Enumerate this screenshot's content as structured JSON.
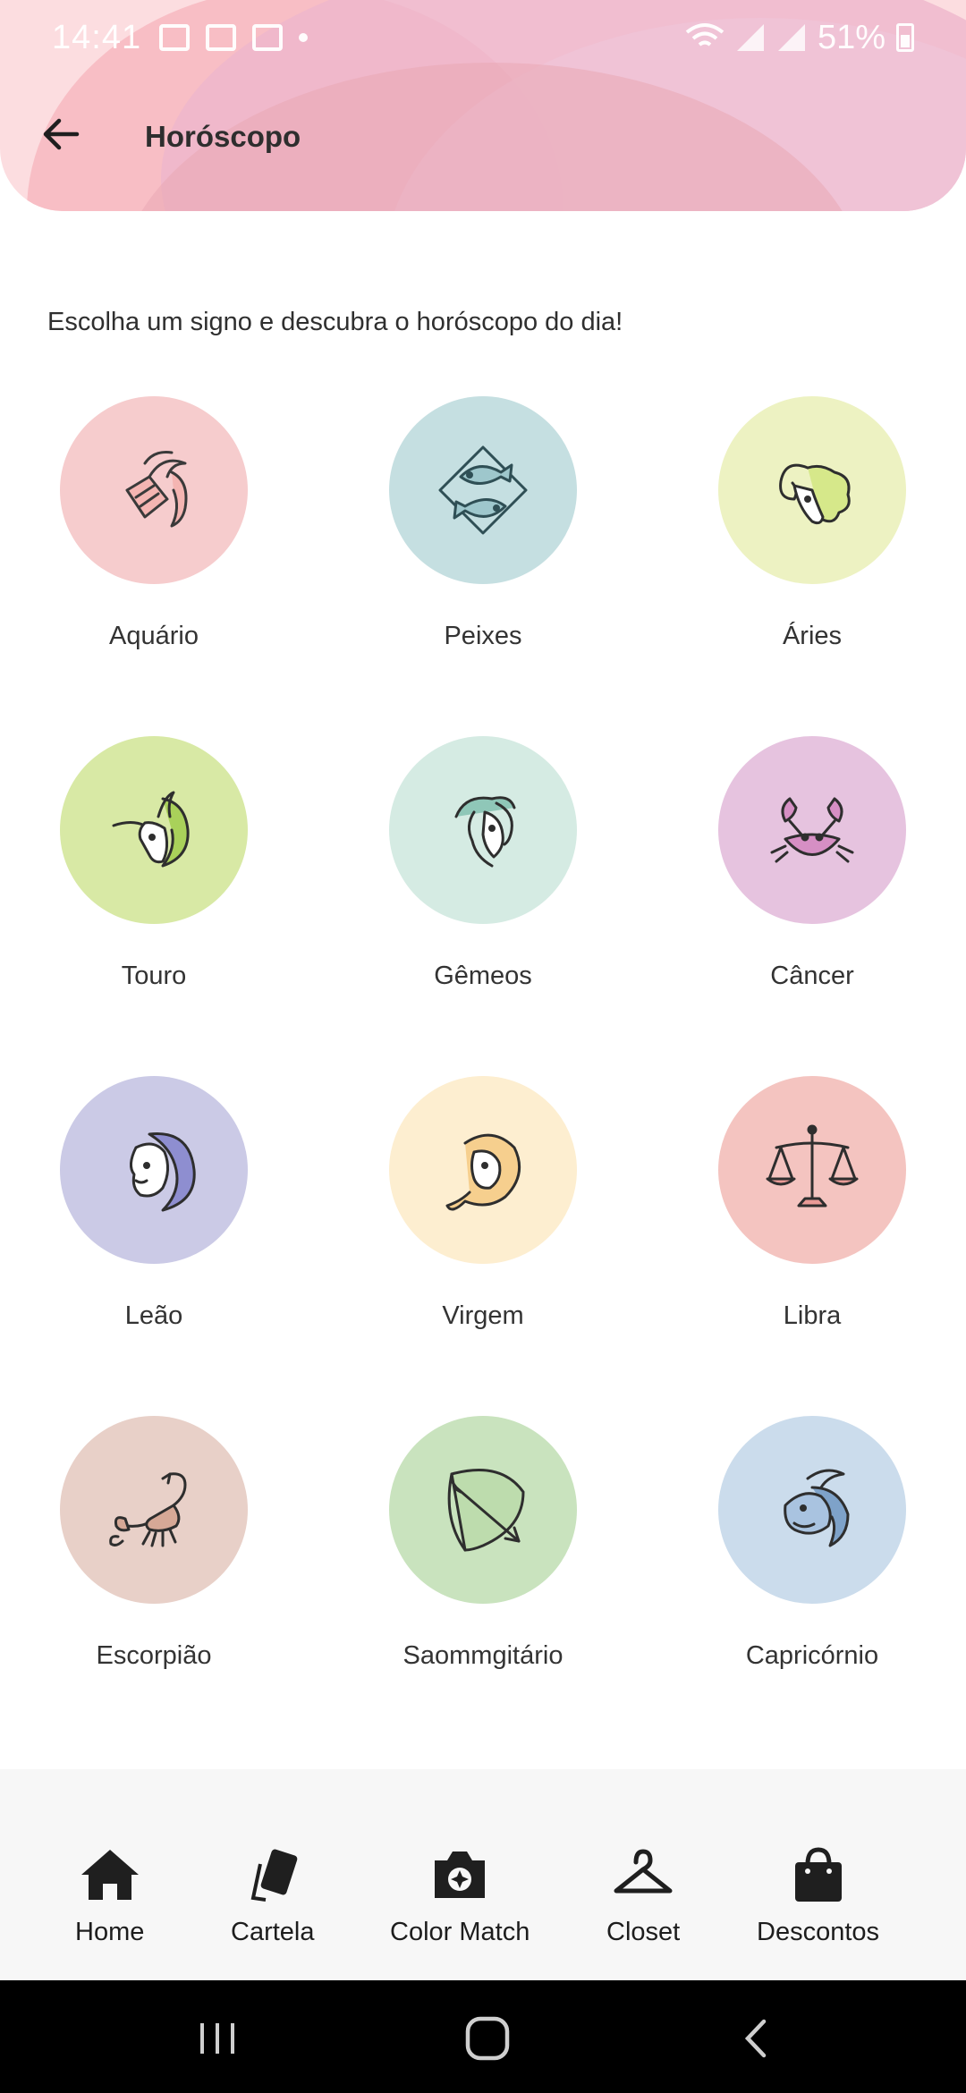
{
  "status_bar": {
    "time": "14:41",
    "battery": "51%"
  },
  "header": {
    "title": "Horóscopo"
  },
  "subtitle": "Escolha um signo e descubra o horóscopo do dia!",
  "colors": {
    "header_gradient": [
      "#fbd3da",
      "#f1c1d9"
    ],
    "icon_stroke": "#3a3a3a"
  },
  "signs": [
    {
      "label": "Aquário",
      "icon": "aquarius-icon",
      "color": "#f6cccd"
    },
    {
      "label": "Peixes",
      "icon": "pisces-icon",
      "color": "#c5dfe1"
    },
    {
      "label": "Áries",
      "icon": "aries-icon",
      "color": "#edf2c2"
    },
    {
      "label": "Touro",
      "icon": "taurus-icon",
      "color": "#d8e9a5"
    },
    {
      "label": "Gêmeos",
      "icon": "gemini-icon",
      "color": "#d5ebe3"
    },
    {
      "label": "Câncer",
      "icon": "cancer-icon",
      "color": "#e6c3df"
    },
    {
      "label": "Leão",
      "icon": "leo-icon",
      "color": "#cbcae6"
    },
    {
      "label": "Virgem",
      "icon": "virgo-icon",
      "color": "#fdeed0"
    },
    {
      "label": "Libra",
      "icon": "libra-icon",
      "color": "#f4c4c0"
    },
    {
      "label": "Escorpião",
      "icon": "scorpio-icon",
      "color": "#e8d0c8"
    },
    {
      "label": "Saommgitário",
      "icon": "sagittarius-icon",
      "color": "#c9e3be"
    },
    {
      "label": "Capricórnio",
      "icon": "capricorn-icon",
      "color": "#cbdcec"
    }
  ],
  "bottom_nav": [
    {
      "label": "Home",
      "icon": "home-icon"
    },
    {
      "label": "Cartela",
      "icon": "cards-icon"
    },
    {
      "label": "Color Match",
      "icon": "camera-icon"
    },
    {
      "label": "Closet",
      "icon": "hanger-icon"
    },
    {
      "label": "Descontos",
      "icon": "shopping-bag-icon"
    }
  ]
}
